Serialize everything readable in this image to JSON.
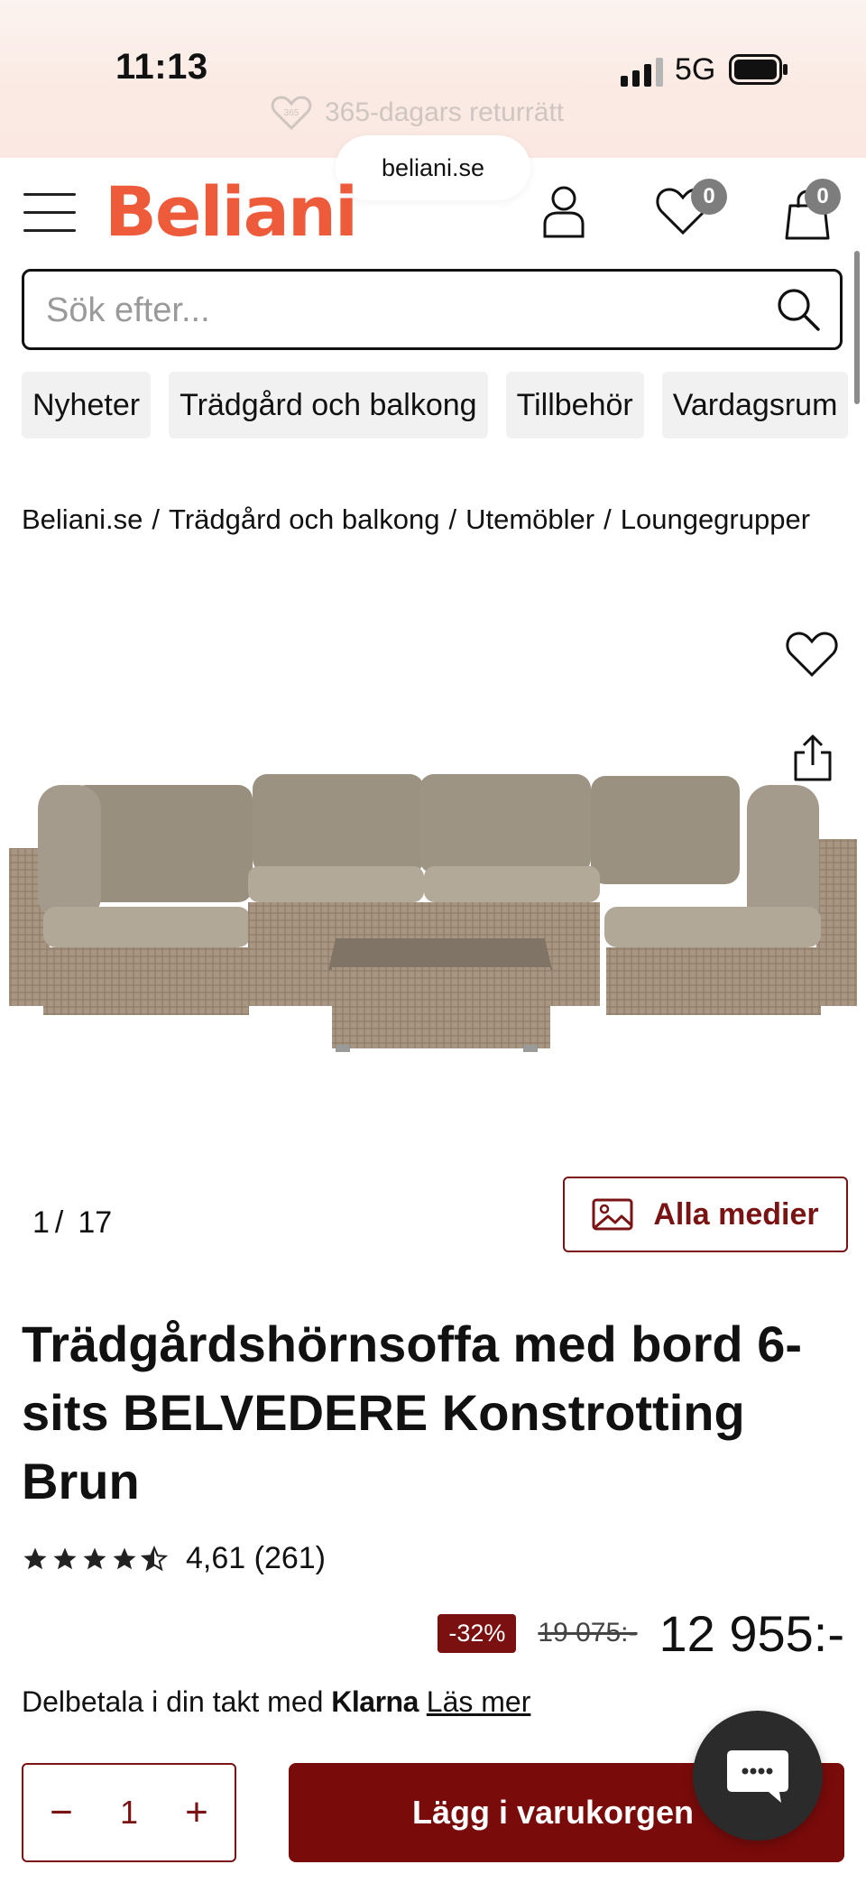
{
  "status_bar": {
    "time": "11:13",
    "network": "5G"
  },
  "promo": {
    "text": "365-dagars returrätt",
    "icon": "heart-365-icon",
    "icon_text": "365"
  },
  "browser": {
    "url": "beliani.se"
  },
  "header": {
    "logo": "Beliani",
    "wishlist_count": "0",
    "cart_count": "0"
  },
  "search": {
    "placeholder": "Sök efter..."
  },
  "categories": [
    "Nyheter",
    "Trädgård och balkong",
    "Tillbehör",
    "Vardagsrum"
  ],
  "breadcrumb": [
    "Beliani.se",
    "Trädgård och balkong",
    "Utemöbler",
    "Loungegrupper"
  ],
  "breadcrumb_sep": "/",
  "gallery": {
    "current": "1",
    "sep": "/",
    "total": "17",
    "media_button": "Alla medier"
  },
  "product": {
    "title": "Trädgårdshörnsoffa med bord 6-sits BELVEDERE Konstrotting Brun",
    "rating": "4,61 (261)",
    "rating_value": 4.61,
    "discount": "-32%",
    "old_price": "19 075:-",
    "price": "12 955:-"
  },
  "klarna": {
    "prefix": "Delbetala i din takt med",
    "brand": "Klarna",
    "link": "Läs mer"
  },
  "cart": {
    "quantity": "1",
    "minus": "−",
    "plus": "+",
    "add_label": "Lägg i varukorgen"
  },
  "colors": {
    "brand": "#ee5b3b",
    "accent": "#7a0b0b",
    "badge": "#7d7d7d"
  }
}
